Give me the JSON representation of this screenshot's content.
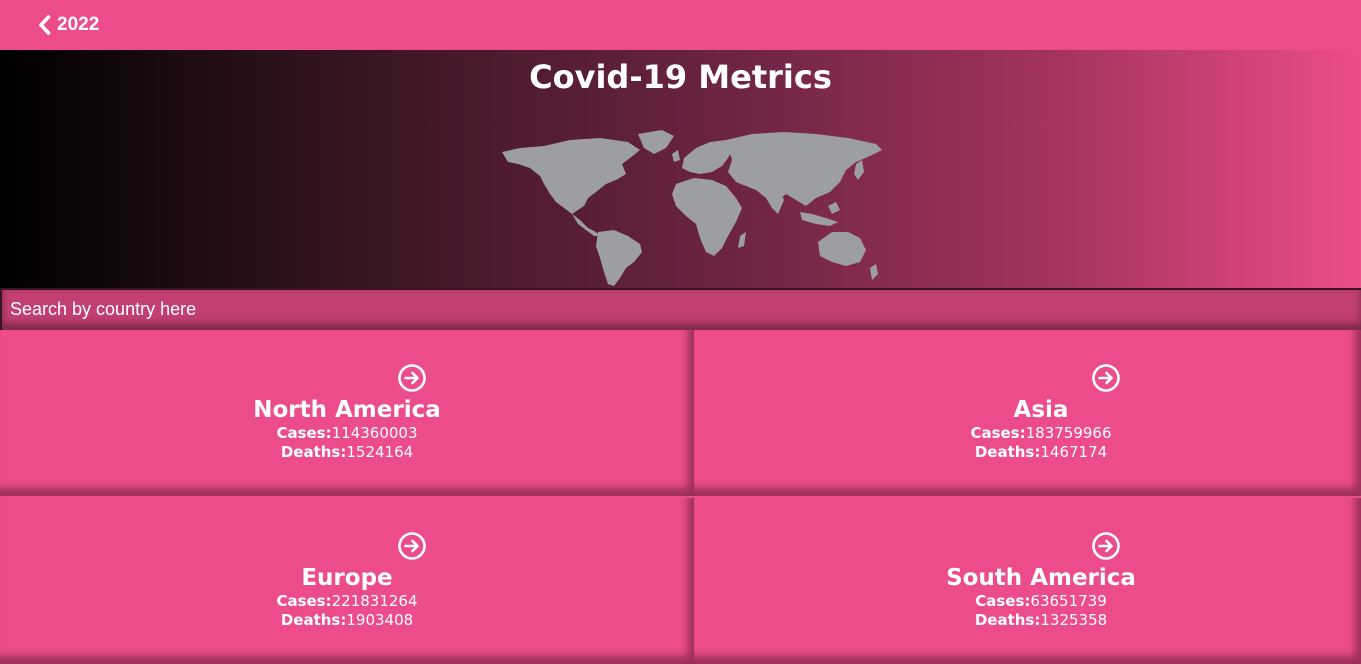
{
  "nav": {
    "back_label": "2022",
    "back_icon": "chevron-left-icon"
  },
  "hero": {
    "title": "Covid-19 Metrics",
    "image": "world-map"
  },
  "search": {
    "placeholder": "Search by country here",
    "value": ""
  },
  "regions": [
    {
      "name": "North America",
      "cases_label": "Cases:",
      "cases": "114360003",
      "deaths_label": "Deaths:",
      "deaths": "1524164"
    },
    {
      "name": "Asia",
      "cases_label": "Cases:",
      "cases": "183759966",
      "deaths_label": "Deaths:",
      "deaths": "1467174"
    },
    {
      "name": "Europe",
      "cases_label": "Cases:",
      "cases": "221831264",
      "deaths_label": "Deaths:",
      "deaths": "1903408"
    },
    {
      "name": "South America",
      "cases_label": "Cases:",
      "cases": "63651739",
      "deaths_label": "Deaths:",
      "deaths": "1325358"
    }
  ],
  "colors": {
    "brand_pink": "#ec4c8b",
    "search_bg": "#c13f72",
    "map_gray": "#9c9ea2",
    "text": "#ffffff"
  }
}
